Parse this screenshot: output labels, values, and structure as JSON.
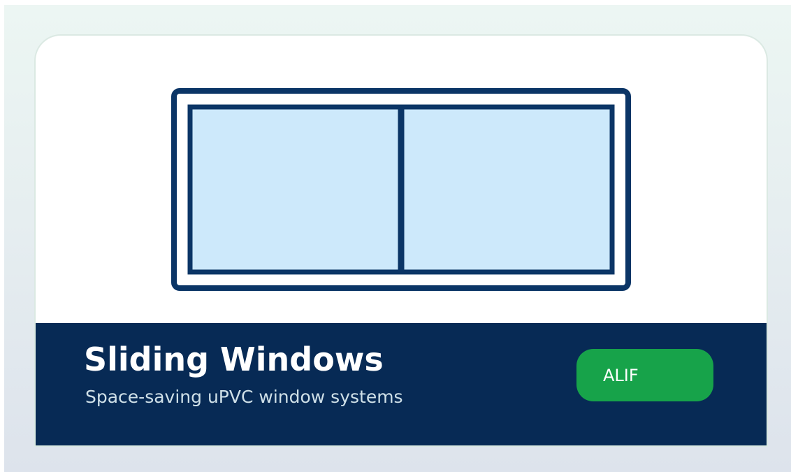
{
  "product": {
    "title": "Sliding Windows",
    "subtitle": "Space-saving uPVC window systems",
    "illustration_icon": "sliding-window-icon"
  },
  "brand_button": {
    "label": "ALIF"
  },
  "colors": {
    "frame": "#0b3566",
    "glass": "#cde9fb",
    "caption_bar": "#072a55",
    "brand_button": "#17a34a",
    "background_top": "#ecf6f3",
    "background_bottom": "#dde3ec"
  }
}
